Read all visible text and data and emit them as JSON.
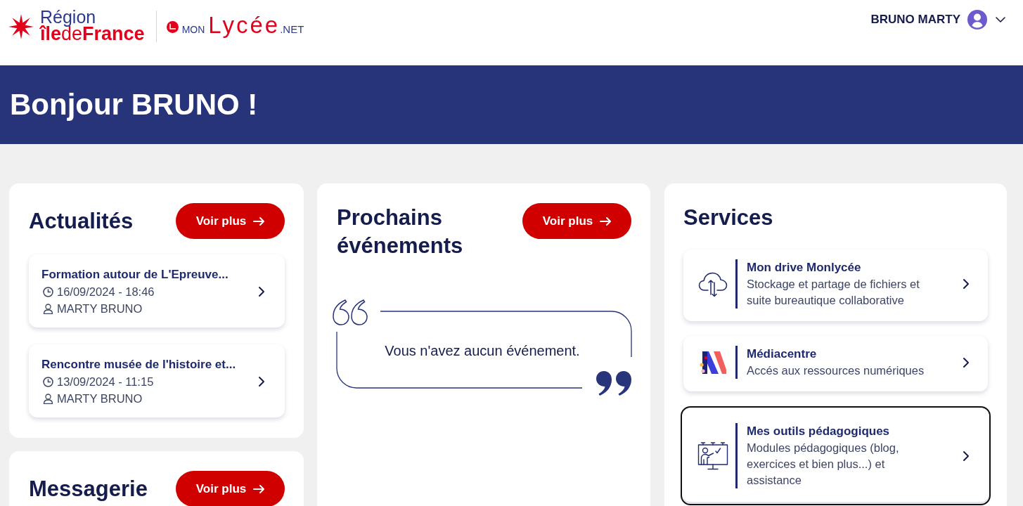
{
  "header": {
    "region_logo": {
      "line_1": "Région",
      "line_2": "**île**de**France**"
    },
    "site_logo": {
      "prefix": "MON",
      "name": "Lycée",
      "suffix": ".NET"
    },
    "user_menu": {
      "name": "BRUNO MARTY"
    }
  },
  "banner": {
    "greeting": "Bonjour BRUNO !"
  },
  "news": {
    "title": "Actualités",
    "button": "Voir plus",
    "items": [
      {
        "title": "Formation autour de L'Epreuve...",
        "date": "16/09/2024 - 18:46",
        "author": "MARTY BRUNO"
      },
      {
        "title": "Rencontre musée de l'histoire et...",
        "date": "13/09/2024 - 11:15",
        "author": "MARTY BRUNO"
      }
    ]
  },
  "events": {
    "title": "Prochains événements",
    "button": "Voir plus",
    "empty_message": "Vous n'avez aucun événement."
  },
  "services": {
    "title": "Services",
    "items": [
      {
        "kind": "drive",
        "title": "Mon drive Monlycée",
        "description": "Stockage et partage de fichiers et suite bureautique collaborative",
        "focused": false
      },
      {
        "kind": "mediacentre",
        "title": "Médiacentre",
        "description": "Accés aux ressources numériques",
        "focused": false
      },
      {
        "kind": "teaching_tools",
        "title": "Mes outils pédagogiques",
        "description": "Modules pédagogiques (blog, exercices et bien plus...) et assistance",
        "focused": true
      }
    ]
  },
  "messages": {
    "title": "Messagerie",
    "button": "Voir plus"
  }
}
